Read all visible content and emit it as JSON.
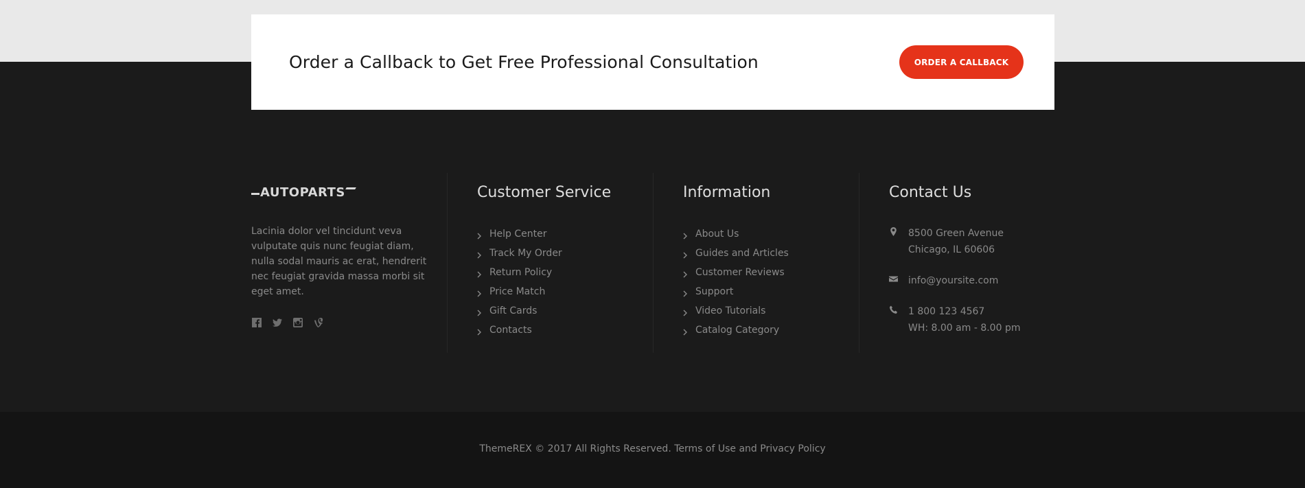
{
  "cta": {
    "title": "Order a Callback to Get Free Professional Consultation",
    "button_label": "ORDER A CALLBACK"
  },
  "footer": {
    "logo": "AUTOPARTS",
    "about_text": "Lacinia dolor vel tincidunt veva vulputate quis nunc feugiat diam, nulla sodal mauris ac erat, hendrerit nec feugiat gravida massa morbi sit eget amet.",
    "social_icons": [
      "facebook-icon",
      "twitter-icon",
      "instagram-icon",
      "vine-icon"
    ],
    "customer_service": {
      "title": "Customer Service",
      "links": [
        "Help Center",
        "Track My Order",
        "Return Policy",
        "Price Match",
        "Gift Cards",
        "Contacts"
      ]
    },
    "information": {
      "title": "Information",
      "links": [
        "About Us",
        "Guides and Articles",
        "Customer Reviews",
        "Support",
        "Video Tutorials",
        "Catalog Category"
      ]
    },
    "contact": {
      "title": "Contact Us",
      "address_line1": "8500 Green Avenue",
      "address_line2": "Chicago, IL 60606",
      "email": "info@yoursite.com",
      "phone": "1 800 123 4567",
      "hours": "WH: 8.00 am - 8.00 pm"
    }
  },
  "copyright": {
    "text": "ThemeREX © 2017 All Rights Reserved.",
    "terms_link": "Terms of Use",
    "and_text": "and",
    "privacy_link": "Privacy Policy"
  },
  "colors": {
    "accent": "#e5331a",
    "footer_bg": "#1b1b1b",
    "bottom_bar_bg": "#141414",
    "top_bg": "#e9e9e9"
  }
}
